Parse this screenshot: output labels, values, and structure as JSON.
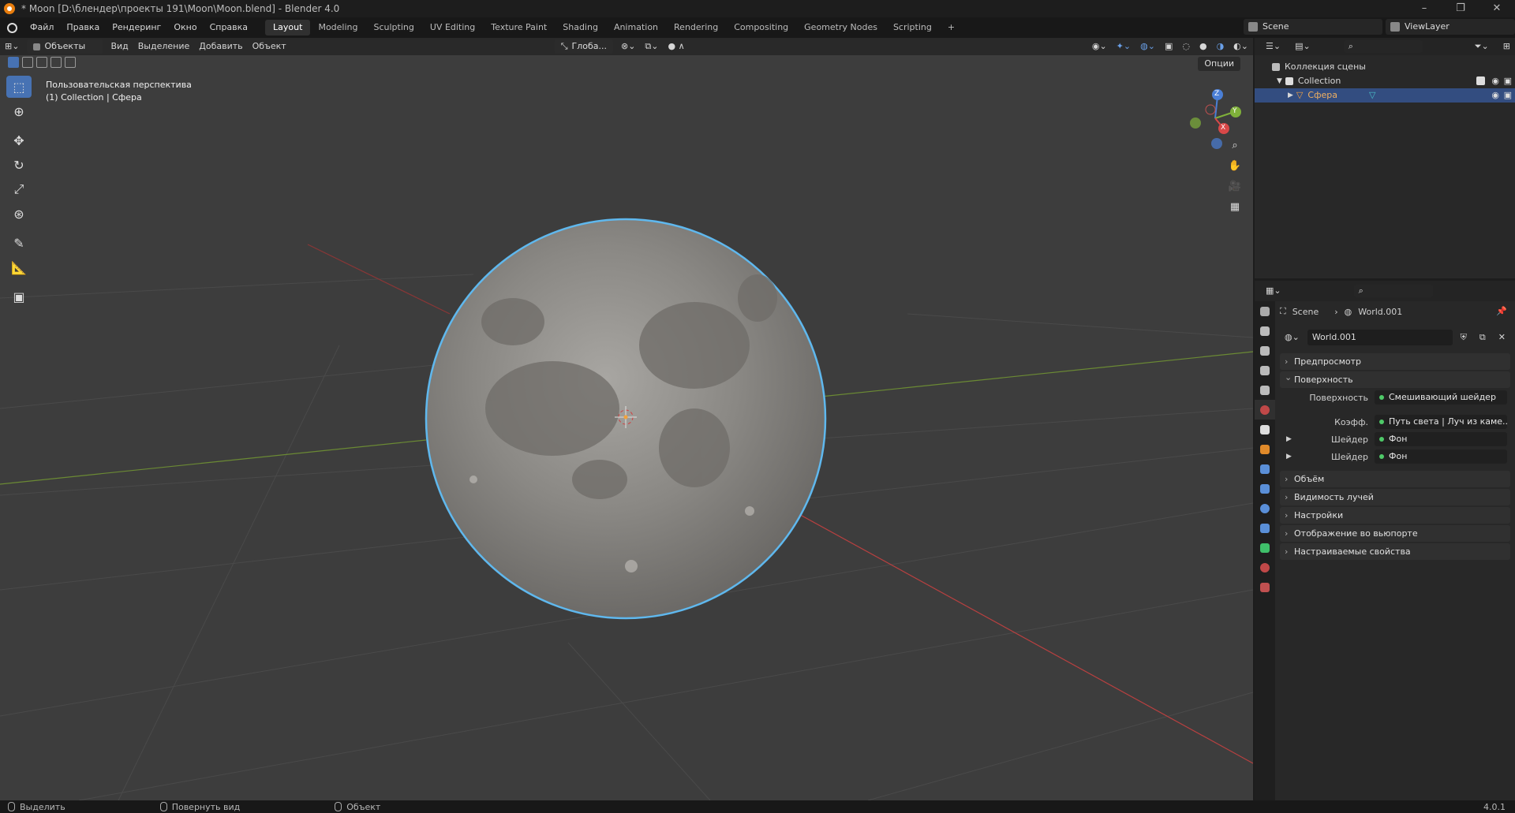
{
  "window": {
    "title": "* Moon [D:\\блендер\\проекты 191\\Moon\\Moon.blend] - Blender 4.0",
    "controls": [
      "–",
      "❐",
      "✕"
    ]
  },
  "menu": [
    "Файл",
    "Правка",
    "Рендеринг",
    "Окно",
    "Справка"
  ],
  "workspaces": [
    "Layout",
    "Modeling",
    "Sculpting",
    "UV Editing",
    "Texture Paint",
    "Shading",
    "Animation",
    "Rendering",
    "Compositing",
    "Geometry Nodes",
    "Scripting",
    "+"
  ],
  "scene": "Scene",
  "view_layer": "ViewLayer",
  "viewport": {
    "mode": "Объекты",
    "header_menu": [
      "Вид",
      "Выделение",
      "Добавить",
      "Объект"
    ],
    "orientation": "Глоба...",
    "options": "Опции",
    "view_name": "Пользовательская перспектива",
    "collection_info": "(1) Collection | Сфера",
    "gizmo": {
      "z": "Z",
      "y": "Y",
      "x": "X"
    }
  },
  "tools": [
    "select-box",
    "cursor",
    "move",
    "rotate",
    "scale",
    "transform",
    "annotate",
    "measure",
    "add-cube"
  ],
  "outliner": {
    "root": "Коллекция сцены",
    "collection": "Collection",
    "object": "Сфера"
  },
  "properties": {
    "breadcrumb_scene": "Scene",
    "breadcrumb_world": "World.001",
    "world_name": "World.001",
    "panels": {
      "preview": "Предпросмотр",
      "surface": "Поверхность",
      "volume": "Объём",
      "ray_visibility": "Видимость лучей",
      "settings": "Настройки",
      "viewport_display": "Отображение во вьюпорте",
      "custom_props": "Настраиваемые свойства"
    },
    "surface_rows": [
      {
        "label": "Поверхность",
        "value": "Смешивающий шейдер"
      },
      {
        "label": "Коэфф.",
        "value": "Путь света | Луч из каме..."
      },
      {
        "label": "Шейдер",
        "value": "Фон"
      },
      {
        "label": "Шейдер",
        "value": "Фон"
      }
    ]
  },
  "status": {
    "select": "Выделить",
    "rotate": "Повернуть вид",
    "object": "Объект",
    "version": "4.0.1"
  }
}
